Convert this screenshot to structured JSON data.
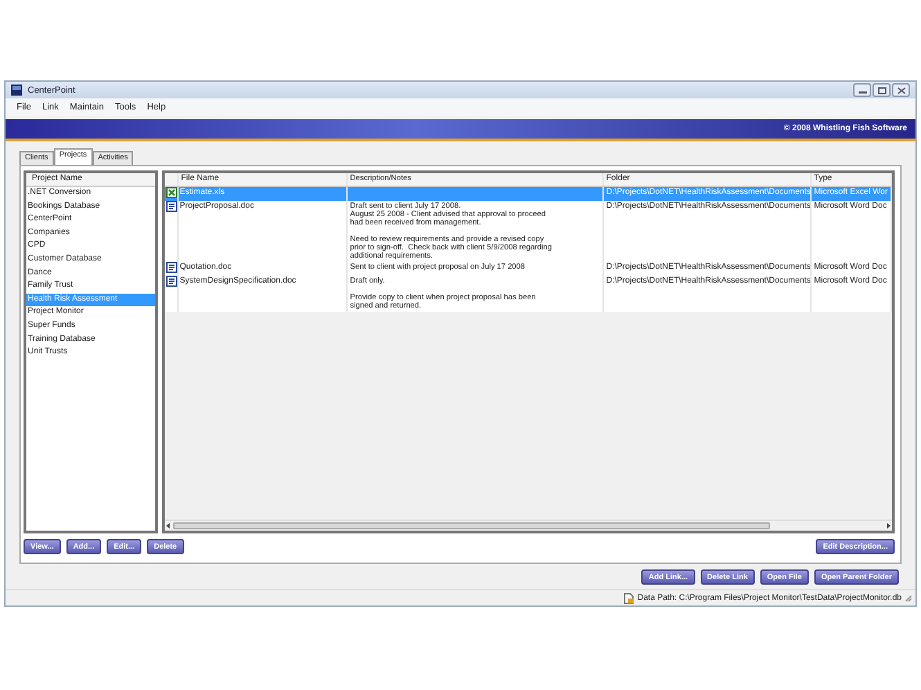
{
  "window": {
    "title": "CenterPoint"
  },
  "menu": [
    "File",
    "Link",
    "Maintain",
    "Tools",
    "Help"
  ],
  "banner": {
    "copyright": "© 2008 Whistling Fish Software"
  },
  "tabs": [
    {
      "label": "Clients",
      "selected": false
    },
    {
      "label": "Projects",
      "selected": true
    },
    {
      "label": "Activities",
      "selected": false
    }
  ],
  "projects": {
    "column": "Project Name",
    "items": [
      {
        "label": ".NET Conversion",
        "selected": false
      },
      {
        "label": "Bookings Database",
        "selected": false
      },
      {
        "label": "CenterPoint",
        "selected": false
      },
      {
        "label": "Companies",
        "selected": false
      },
      {
        "label": "CPD",
        "selected": false
      },
      {
        "label": "Customer Database",
        "selected": false
      },
      {
        "label": "Dance",
        "selected": false
      },
      {
        "label": "Family Trust",
        "selected": false
      },
      {
        "label": "Health Risk Assessment",
        "selected": true
      },
      {
        "label": "Project Monitor",
        "selected": false
      },
      {
        "label": "Super Funds",
        "selected": false
      },
      {
        "label": "Training Database",
        "selected": false
      },
      {
        "label": "Unit Trusts",
        "selected": false
      }
    ]
  },
  "files": {
    "columns": [
      "File Name",
      "Description/Notes",
      "Folder",
      "Type"
    ],
    "rows": [
      {
        "kind": "excel",
        "selected": true,
        "name": "Estimate.xls",
        "notes": "",
        "folder": "D:\\Projects\\DotNET\\HealthRiskAssessment\\Documents",
        "type": "Microsoft Excel Wor"
      },
      {
        "kind": "word",
        "selected": false,
        "name": "ProjectProposal.doc",
        "notes": "Draft sent to client July 17 2008.\nAugust 25 2008 - Client advised that approval to proceed\nhad been received from management.\n\nNeed to review requirements and provide a revised copy\nprior to sign-off.  Check back with client 5/9/2008 regarding\nadditional requirements.",
        "folder": "D:\\Projects\\DotNET\\HealthRiskAssessment\\Documents",
        "type": "Microsoft Word Doc"
      },
      {
        "kind": "word",
        "selected": false,
        "name": "Quotation.doc",
        "notes": "Sent to client with project proposal on July 17 2008",
        "folder": "D:\\Projects\\DotNET\\HealthRiskAssessment\\Documents",
        "type": "Microsoft Word Doc"
      },
      {
        "kind": "word",
        "selected": false,
        "name": "SystemDesignSpecification.doc",
        "notes": "Draft only.\n\nProvide copy to client when project proposal has been\nsigned and returned.",
        "folder": "D:\\Projects\\DotNET\\HealthRiskAssessment\\Documents",
        "type": "Microsoft Word Doc"
      }
    ]
  },
  "project_buttons": [
    "View...",
    "Add...",
    "Edit...",
    "Delete"
  ],
  "description_button": "Edit Description...",
  "link_buttons": [
    "Add Link...",
    "Delete Link",
    "Open File",
    "Open Parent Folder"
  ],
  "status_bar": {
    "text": "Data Path: C:\\Program Files\\Project Monitor\\TestData\\ProjectMonitor.db"
  }
}
